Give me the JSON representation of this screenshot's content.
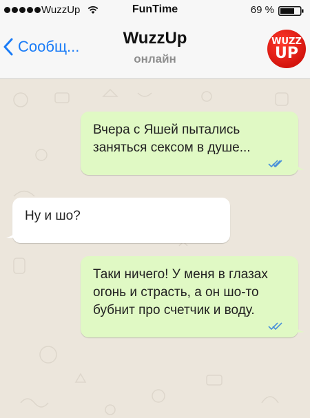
{
  "status_bar": {
    "carrier": "WuzzUp",
    "time": "FunTime",
    "battery": "69 %"
  },
  "header": {
    "back_label": "Сообщ...",
    "title": "WuzzUp",
    "status": "онлайн",
    "avatar": {
      "line1": "WUZZ",
      "line2": "UP",
      "color": "#e0221a"
    }
  },
  "colors": {
    "outgoing_bubble": "#e0f9c4",
    "incoming_bubble": "#ffffff",
    "accent": "#1a7cf7",
    "read_ticks": "#4a90d9"
  },
  "messages": [
    {
      "direction": "outgoing",
      "text": "Вчера с Яшей пытались заняться сексом в душе...",
      "status": "read"
    },
    {
      "direction": "incoming",
      "text": "Ну и шо?"
    },
    {
      "direction": "outgoing",
      "text": "Таки ничего! У меня в глазах огонь и страсть, а он шо-то бубнит про счетчик и воду.",
      "status": "read"
    }
  ]
}
